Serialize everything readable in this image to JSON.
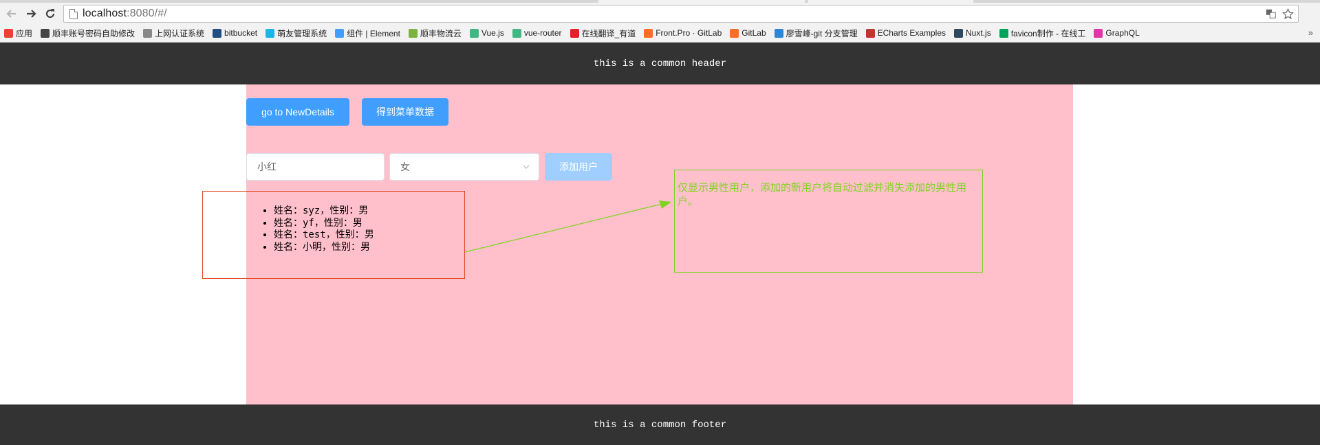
{
  "browser": {
    "url_host": "localhost",
    "url_rest": ":8080/#/",
    "bookmarks": [
      {
        "label": "应用",
        "icon": "apps-grid-icon",
        "color": "#e94235"
      },
      {
        "label": "顺丰账号密码自助修改",
        "icon": "sf-icon",
        "color": "#444444"
      },
      {
        "label": "上网认证系统",
        "icon": "page-icon",
        "color": "#888888"
      },
      {
        "label": "bitbucket",
        "icon": "bitbucket-icon",
        "color": "#205081"
      },
      {
        "label": "萌友管理系统",
        "icon": "mengyou-icon",
        "color": "#1bb6e8"
      },
      {
        "label": "组件 | Element",
        "icon": "element-icon",
        "color": "#409eff"
      },
      {
        "label": "顺丰物流云",
        "icon": "sf-cloud-icon",
        "color": "#7cb342"
      },
      {
        "label": "Vue.js",
        "icon": "vue-icon",
        "color": "#41b883"
      },
      {
        "label": "vue-router",
        "icon": "vue-icon",
        "color": "#41b883"
      },
      {
        "label": "在线翻译_有道",
        "icon": "youdao-icon",
        "color": "#e4202a"
      },
      {
        "label": "Front.Pro · GitLab",
        "icon": "gitlab-icon",
        "color": "#fc6d26"
      },
      {
        "label": "GitLab",
        "icon": "gitlab-icon",
        "color": "#fc6d26"
      },
      {
        "label": "廖雪峰-git 分支管理",
        "icon": "rocket-icon",
        "color": "#2b88d8"
      },
      {
        "label": "ECharts Examples",
        "icon": "echarts-icon",
        "color": "#c23531"
      },
      {
        "label": "Nuxt.js",
        "icon": "nuxt-icon",
        "color": "#2e495e"
      },
      {
        "label": "favicon制作 - 在线工",
        "icon": "favicon-tool-icon",
        "color": "#00a35a"
      },
      {
        "label": "GraphQL",
        "icon": "graphql-icon",
        "color": "#e535ab"
      }
    ]
  },
  "header": {
    "text": "this is a common header"
  },
  "footer": {
    "text": "this is a common footer"
  },
  "actions": {
    "go_details_label": "go to NewDetails",
    "get_menu_label": "得到菜单数据"
  },
  "form": {
    "name_value": "小红",
    "gender_value": "女",
    "add_user_label": "添加用户"
  },
  "users": [
    "姓名：syz，性别：男",
    "姓名：yf，性别：男",
    "姓名：test，性别：男",
    "姓名：小明，性别：男"
  ],
  "annotation": {
    "note": "仅显示男性用户，添加的新用户将自动过滤并消失添加的男性用户。"
  }
}
